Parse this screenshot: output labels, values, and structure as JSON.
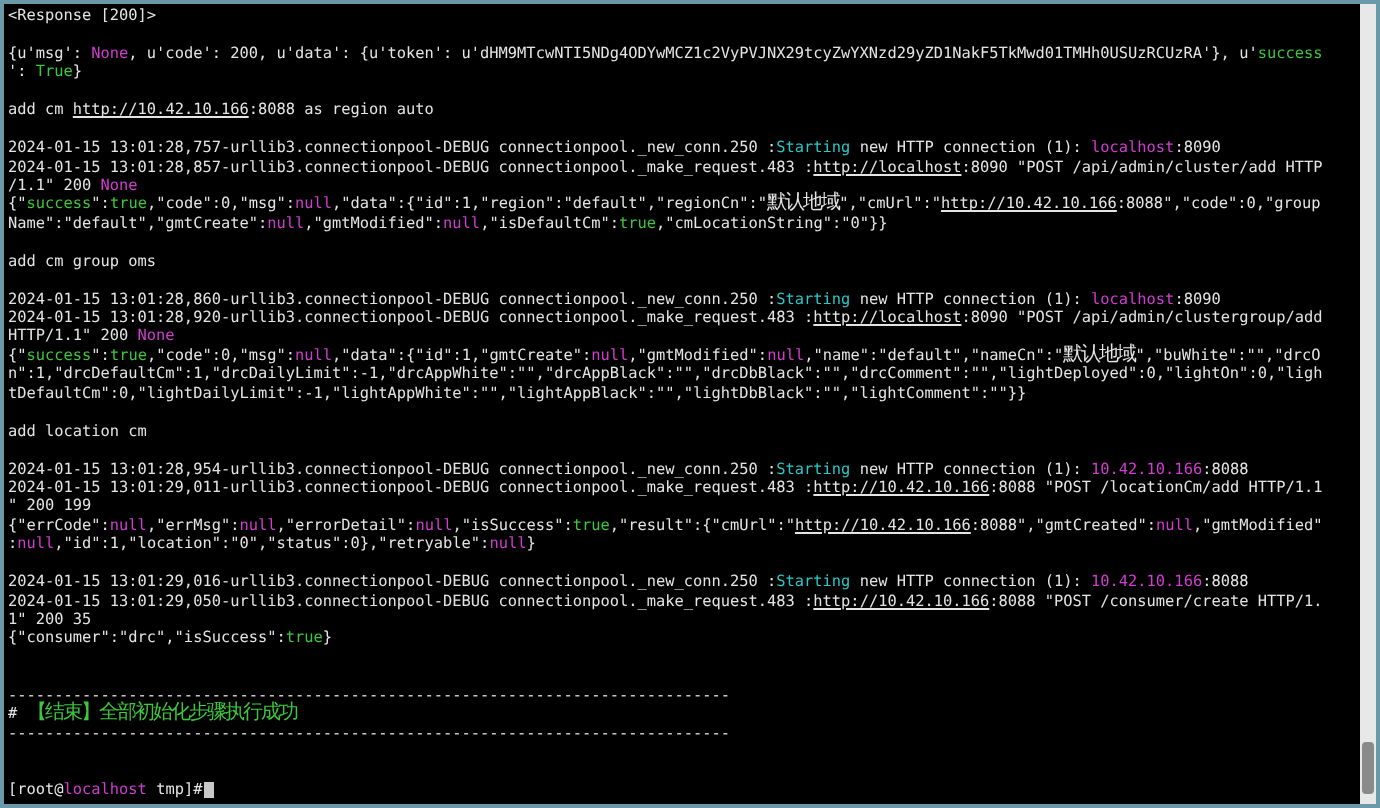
{
  "terminal": {
    "lines": [
      {
        "kind": "text",
        "segments": [
          {
            "kind": "plain",
            "text": "<Response [200]>"
          }
        ]
      },
      {
        "kind": "blank"
      },
      {
        "kind": "text",
        "segments": [
          {
            "kind": "plain",
            "text": "{u'msg': "
          },
          {
            "kind": "keyword",
            "text": "None"
          },
          {
            "kind": "plain",
            "text": ", u'code': 200, u'data': {u'token': u'dHM9MTcwNTI5NDg4ODYwMCZ1c2VyPVJNX29tcyZwYXNzd29yZD1NakF5TkMwd01TMHh0USUzRCUzRA'}, u'"
          },
          {
            "kind": "value",
            "text": "success"
          }
        ]
      },
      {
        "kind": "text",
        "segments": [
          {
            "kind": "plain",
            "text": "': "
          },
          {
            "kind": "value",
            "text": "True"
          },
          {
            "kind": "plain",
            "text": "}"
          }
        ]
      },
      {
        "kind": "blank"
      },
      {
        "kind": "text",
        "segments": [
          {
            "kind": "plain",
            "text": "add cm "
          },
          {
            "kind": "link",
            "text": "http://10.42.10.166"
          },
          {
            "kind": "plain",
            "text": ":8088 as region auto"
          }
        ]
      },
      {
        "kind": "blank"
      },
      {
        "kind": "text",
        "segments": [
          {
            "kind": "plain",
            "text": "2024-01-15 13:01:28,757-urllib3.connectionpool-DEBUG connectionpool._new_conn.250 :"
          },
          {
            "kind": "status",
            "text": "Starting"
          },
          {
            "kind": "plain",
            "text": " new HTTP connection (1): "
          },
          {
            "kind": "keyword",
            "text": "localhost"
          },
          {
            "kind": "plain",
            "text": ":8090"
          }
        ]
      },
      {
        "kind": "text",
        "segments": [
          {
            "kind": "plain",
            "text": "2024-01-15 13:01:28,857-urllib3.connectionpool-DEBUG connectionpool._make_request.483 :"
          },
          {
            "kind": "link",
            "text": "http://localhost"
          },
          {
            "kind": "plain",
            "text": ":8090 \"POST /api/admin/cluster/add HTTP"
          }
        ]
      },
      {
        "kind": "text",
        "segments": [
          {
            "kind": "plain",
            "text": "/1.1\" 200 "
          },
          {
            "kind": "keyword",
            "text": "None"
          }
        ]
      },
      {
        "kind": "text",
        "segments": [
          {
            "kind": "plain",
            "text": "{\""
          },
          {
            "kind": "value",
            "text": "success"
          },
          {
            "kind": "plain",
            "text": "\":"
          },
          {
            "kind": "value",
            "text": "true"
          },
          {
            "kind": "plain",
            "text": ",\"code\":0,\"msg\":"
          },
          {
            "kind": "keyword",
            "text": "null"
          },
          {
            "kind": "plain",
            "text": ",\"data\":{\"id\":1,\"region\":\"default\",\"regionCn\":\"默认地域\",\"cmUrl\":\""
          },
          {
            "kind": "link",
            "text": "http://10.42.10.166"
          },
          {
            "kind": "plain",
            "text": ":8088\",\"code\":0,\"group"
          }
        ]
      },
      {
        "kind": "text",
        "segments": [
          {
            "kind": "plain",
            "text": "Name\":\"default\",\"gmtCreate\":"
          },
          {
            "kind": "keyword",
            "text": "null"
          },
          {
            "kind": "plain",
            "text": ",\"gmtModified\":"
          },
          {
            "kind": "keyword",
            "text": "null"
          },
          {
            "kind": "plain",
            "text": ",\"isDefaultCm\":"
          },
          {
            "kind": "value",
            "text": "true"
          },
          {
            "kind": "plain",
            "text": ",\"cmLocationString\":\"0\"}}"
          }
        ]
      },
      {
        "kind": "blank"
      },
      {
        "kind": "text",
        "segments": [
          {
            "kind": "plain",
            "text": "add cm group oms"
          }
        ]
      },
      {
        "kind": "blank"
      },
      {
        "kind": "text",
        "segments": [
          {
            "kind": "plain",
            "text": "2024-01-15 13:01:28,860-urllib3.connectionpool-DEBUG connectionpool._new_conn.250 :"
          },
          {
            "kind": "status",
            "text": "Starting"
          },
          {
            "kind": "plain",
            "text": " new HTTP connection (1): "
          },
          {
            "kind": "keyword",
            "text": "localhost"
          },
          {
            "kind": "plain",
            "text": ":8090"
          }
        ]
      },
      {
        "kind": "text",
        "segments": [
          {
            "kind": "plain",
            "text": "2024-01-15 13:01:28,920-urllib3.connectionpool-DEBUG connectionpool._make_request.483 :"
          },
          {
            "kind": "link",
            "text": "http://localhost"
          },
          {
            "kind": "plain",
            "text": ":8090 \"POST /api/admin/clustergroup/add"
          }
        ]
      },
      {
        "kind": "text",
        "segments": [
          {
            "kind": "plain",
            "text": " HTTP/1.1\" 200 "
          },
          {
            "kind": "keyword",
            "text": "None"
          }
        ]
      },
      {
        "kind": "text",
        "segments": [
          {
            "kind": "plain",
            "text": "{\""
          },
          {
            "kind": "value",
            "text": "success"
          },
          {
            "kind": "plain",
            "text": "\":"
          },
          {
            "kind": "value",
            "text": "true"
          },
          {
            "kind": "plain",
            "text": ",\"code\":0,\"msg\":"
          },
          {
            "kind": "keyword",
            "text": "null"
          },
          {
            "kind": "plain",
            "text": ",\"data\":{\"id\":1,\"gmtCreate\":"
          },
          {
            "kind": "keyword",
            "text": "null"
          },
          {
            "kind": "plain",
            "text": ",\"gmtModified\":"
          },
          {
            "kind": "keyword",
            "text": "null"
          },
          {
            "kind": "plain",
            "text": ",\"name\":\"default\",\"nameCn\":\"默认地域\",\"buWhite\":\"\",\"drcO"
          }
        ]
      },
      {
        "kind": "text",
        "segments": [
          {
            "kind": "plain",
            "text": "n\":1,\"drcDefaultCm\":1,\"drcDailyLimit\":-1,\"drcAppWhite\":\"\",\"drcAppBlack\":\"\",\"drcDbBlack\":\"\",\"drcComment\":\"\",\"lightDeployed\":0,\"lightOn\":0,\"ligh"
          }
        ]
      },
      {
        "kind": "text",
        "segments": [
          {
            "kind": "plain",
            "text": "tDefaultCm\":0,\"lightDailyLimit\":-1,\"lightAppWhite\":\"\",\"lightAppBlack\":\"\",\"lightDbBlack\":\"\",\"lightComment\":\"\"}}"
          }
        ]
      },
      {
        "kind": "blank"
      },
      {
        "kind": "text",
        "segments": [
          {
            "kind": "plain",
            "text": "add location cm"
          }
        ]
      },
      {
        "kind": "blank"
      },
      {
        "kind": "text",
        "segments": [
          {
            "kind": "plain",
            "text": "2024-01-15 13:01:28,954-urllib3.connectionpool-DEBUG connectionpool._new_conn.250 :"
          },
          {
            "kind": "status",
            "text": "Starting"
          },
          {
            "kind": "plain",
            "text": " new HTTP connection (1): "
          },
          {
            "kind": "keyword",
            "text": "10.42.10.166"
          },
          {
            "kind": "plain",
            "text": ":8088"
          }
        ]
      },
      {
        "kind": "text",
        "segments": [
          {
            "kind": "plain",
            "text": "2024-01-15 13:01:29,011-urllib3.connectionpool-DEBUG connectionpool._make_request.483 :"
          },
          {
            "kind": "link",
            "text": "http://10.42.10.166"
          },
          {
            "kind": "plain",
            "text": ":8088 \"POST /locationCm/add HTTP/1.1"
          }
        ]
      },
      {
        "kind": "text",
        "segments": [
          {
            "kind": "plain",
            "text": "\" 200 199"
          }
        ]
      },
      {
        "kind": "text",
        "segments": [
          {
            "kind": "plain",
            "text": "{\"errCode\":"
          },
          {
            "kind": "keyword",
            "text": "null"
          },
          {
            "kind": "plain",
            "text": ",\"errMsg\":"
          },
          {
            "kind": "keyword",
            "text": "null"
          },
          {
            "kind": "plain",
            "text": ",\"errorDetail\":"
          },
          {
            "kind": "keyword",
            "text": "null"
          },
          {
            "kind": "plain",
            "text": ",\"isSuccess\":"
          },
          {
            "kind": "value",
            "text": "true"
          },
          {
            "kind": "plain",
            "text": ",\"result\":{\"cmUrl\":\""
          },
          {
            "kind": "link",
            "text": "http://10.42.10.166"
          },
          {
            "kind": "plain",
            "text": ":8088\",\"gmtCreated\":"
          },
          {
            "kind": "keyword",
            "text": "null"
          },
          {
            "kind": "plain",
            "text": ",\"gmtModified\""
          }
        ]
      },
      {
        "kind": "text",
        "segments": [
          {
            "kind": "plain",
            "text": ":"
          },
          {
            "kind": "keyword",
            "text": "null"
          },
          {
            "kind": "plain",
            "text": ",\"id\":1,\"location\":\"0\",\"status\":0},\"retryable\":"
          },
          {
            "kind": "keyword",
            "text": "null"
          },
          {
            "kind": "plain",
            "text": "}"
          }
        ]
      },
      {
        "kind": "blank"
      },
      {
        "kind": "text",
        "segments": [
          {
            "kind": "plain",
            "text": "2024-01-15 13:01:29,016-urllib3.connectionpool-DEBUG connectionpool._new_conn.250 :"
          },
          {
            "kind": "status",
            "text": "Starting"
          },
          {
            "kind": "plain",
            "text": " new HTTP connection (1): "
          },
          {
            "kind": "keyword",
            "text": "10.42.10.166"
          },
          {
            "kind": "plain",
            "text": ":8088"
          }
        ]
      },
      {
        "kind": "text",
        "segments": [
          {
            "kind": "plain",
            "text": "2024-01-15 13:01:29,050-urllib3.connectionpool-DEBUG connectionpool._make_request.483 :"
          },
          {
            "kind": "link",
            "text": "http://10.42.10.166"
          },
          {
            "kind": "plain",
            "text": ":8088 \"POST /consumer/create HTTP/1."
          }
        ]
      },
      {
        "kind": "text",
        "segments": [
          {
            "kind": "plain",
            "text": "1\" 200 35"
          }
        ]
      },
      {
        "kind": "text",
        "segments": [
          {
            "kind": "plain",
            "text": "{\"consumer\":\"drc\",\"isSuccess\":"
          },
          {
            "kind": "value",
            "text": "true"
          },
          {
            "kind": "plain",
            "text": "}"
          }
        ]
      },
      {
        "kind": "blank"
      },
      {
        "kind": "blank"
      },
      {
        "kind": "text",
        "segments": [
          {
            "kind": "plain",
            "text": "------------------------------------------------------------------------------"
          }
        ]
      },
      {
        "kind": "text",
        "segments": [
          {
            "kind": "plain",
            "text": "# "
          },
          {
            "kind": "value",
            "text": "【结束】全部初始化步骤执行成功"
          }
        ]
      },
      {
        "kind": "text",
        "segments": [
          {
            "kind": "plain",
            "text": "------------------------------------------------------------------------------"
          }
        ]
      },
      {
        "kind": "blank"
      },
      {
        "kind": "blank"
      },
      {
        "kind": "prompt",
        "cursor": true,
        "segments": [
          {
            "kind": "plain",
            "text": "[root@"
          },
          {
            "kind": "keyword",
            "text": "localhost"
          },
          {
            "kind": "plain",
            "text": " tmp]# "
          }
        ]
      }
    ]
  }
}
